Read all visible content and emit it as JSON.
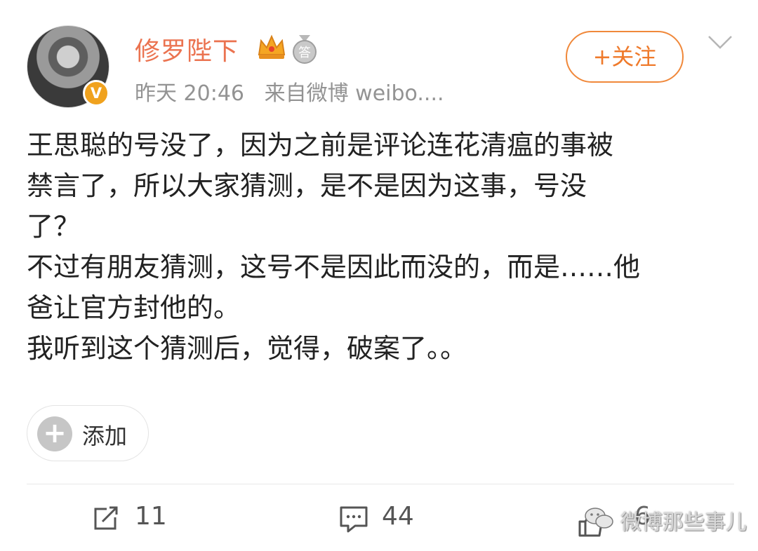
{
  "post": {
    "author": {
      "name": "修罗陛下",
      "verified_badge": "V",
      "medal_char": "答"
    },
    "meta": {
      "time": "昨天 20:46",
      "source": "来自微博 weibo...."
    },
    "follow_label": "+关注",
    "text_lines": [
      "王思聪的号没了，因为之前是评论连花清瘟的事被",
      "禁言了，所以大家猜测，是不是因为这事，号没",
      "了？",
      "不过有朋友猜测，这号不是因此而没的，而是……他",
      "爸让官方封他的。",
      "我听到这个猜测后，觉得，破案了。。"
    ],
    "add_label": "添加"
  },
  "actions": {
    "repost_count": "11",
    "comment_count": "44",
    "like_count_partial": "6"
  },
  "watermark": {
    "text": "微博那些事儿"
  },
  "icons": [
    "crown-icon",
    "medal-icon",
    "chevron-down-icon",
    "repost-icon",
    "comment-icon",
    "like-icon",
    "wechat-logo-icon"
  ],
  "colors": {
    "username": "#eb7350",
    "follow_border": "#f0883a",
    "meta_text": "#939393",
    "vip_badge": "#f0a21e"
  }
}
